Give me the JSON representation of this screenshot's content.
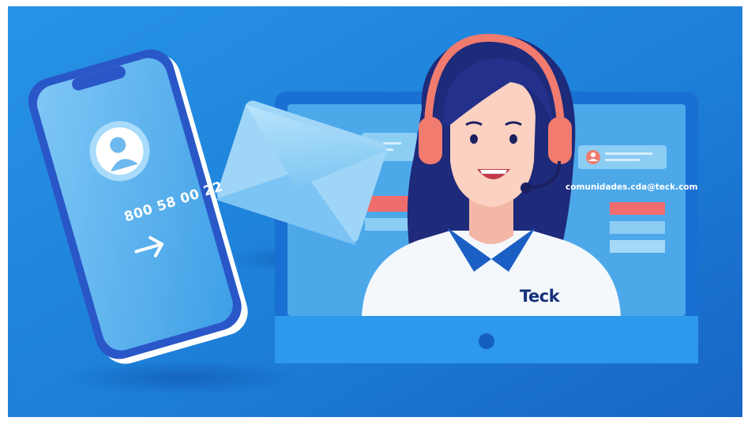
{
  "phone": {
    "number": "800 58 00 22",
    "arrow_icon": "arrow-right-icon",
    "avatar_icon": "user-avatar-icon"
  },
  "email": {
    "address": "comunidades.cda@teck.com",
    "envelope_icon": "envelope-icon"
  },
  "agent": {
    "brand": "Teck",
    "headset_icon": "headset-icon"
  },
  "colors": {
    "background": "#1f7fd6",
    "phone_screen": "#5ab3ee",
    "monitor_frame": "#1a6fd3",
    "monitor_screen": "#4da8ea",
    "headset": "#f07b6e",
    "accent_red": "#f06d6d",
    "shirt_collar": "#1c5fc4",
    "text_brand": "#13307a"
  }
}
